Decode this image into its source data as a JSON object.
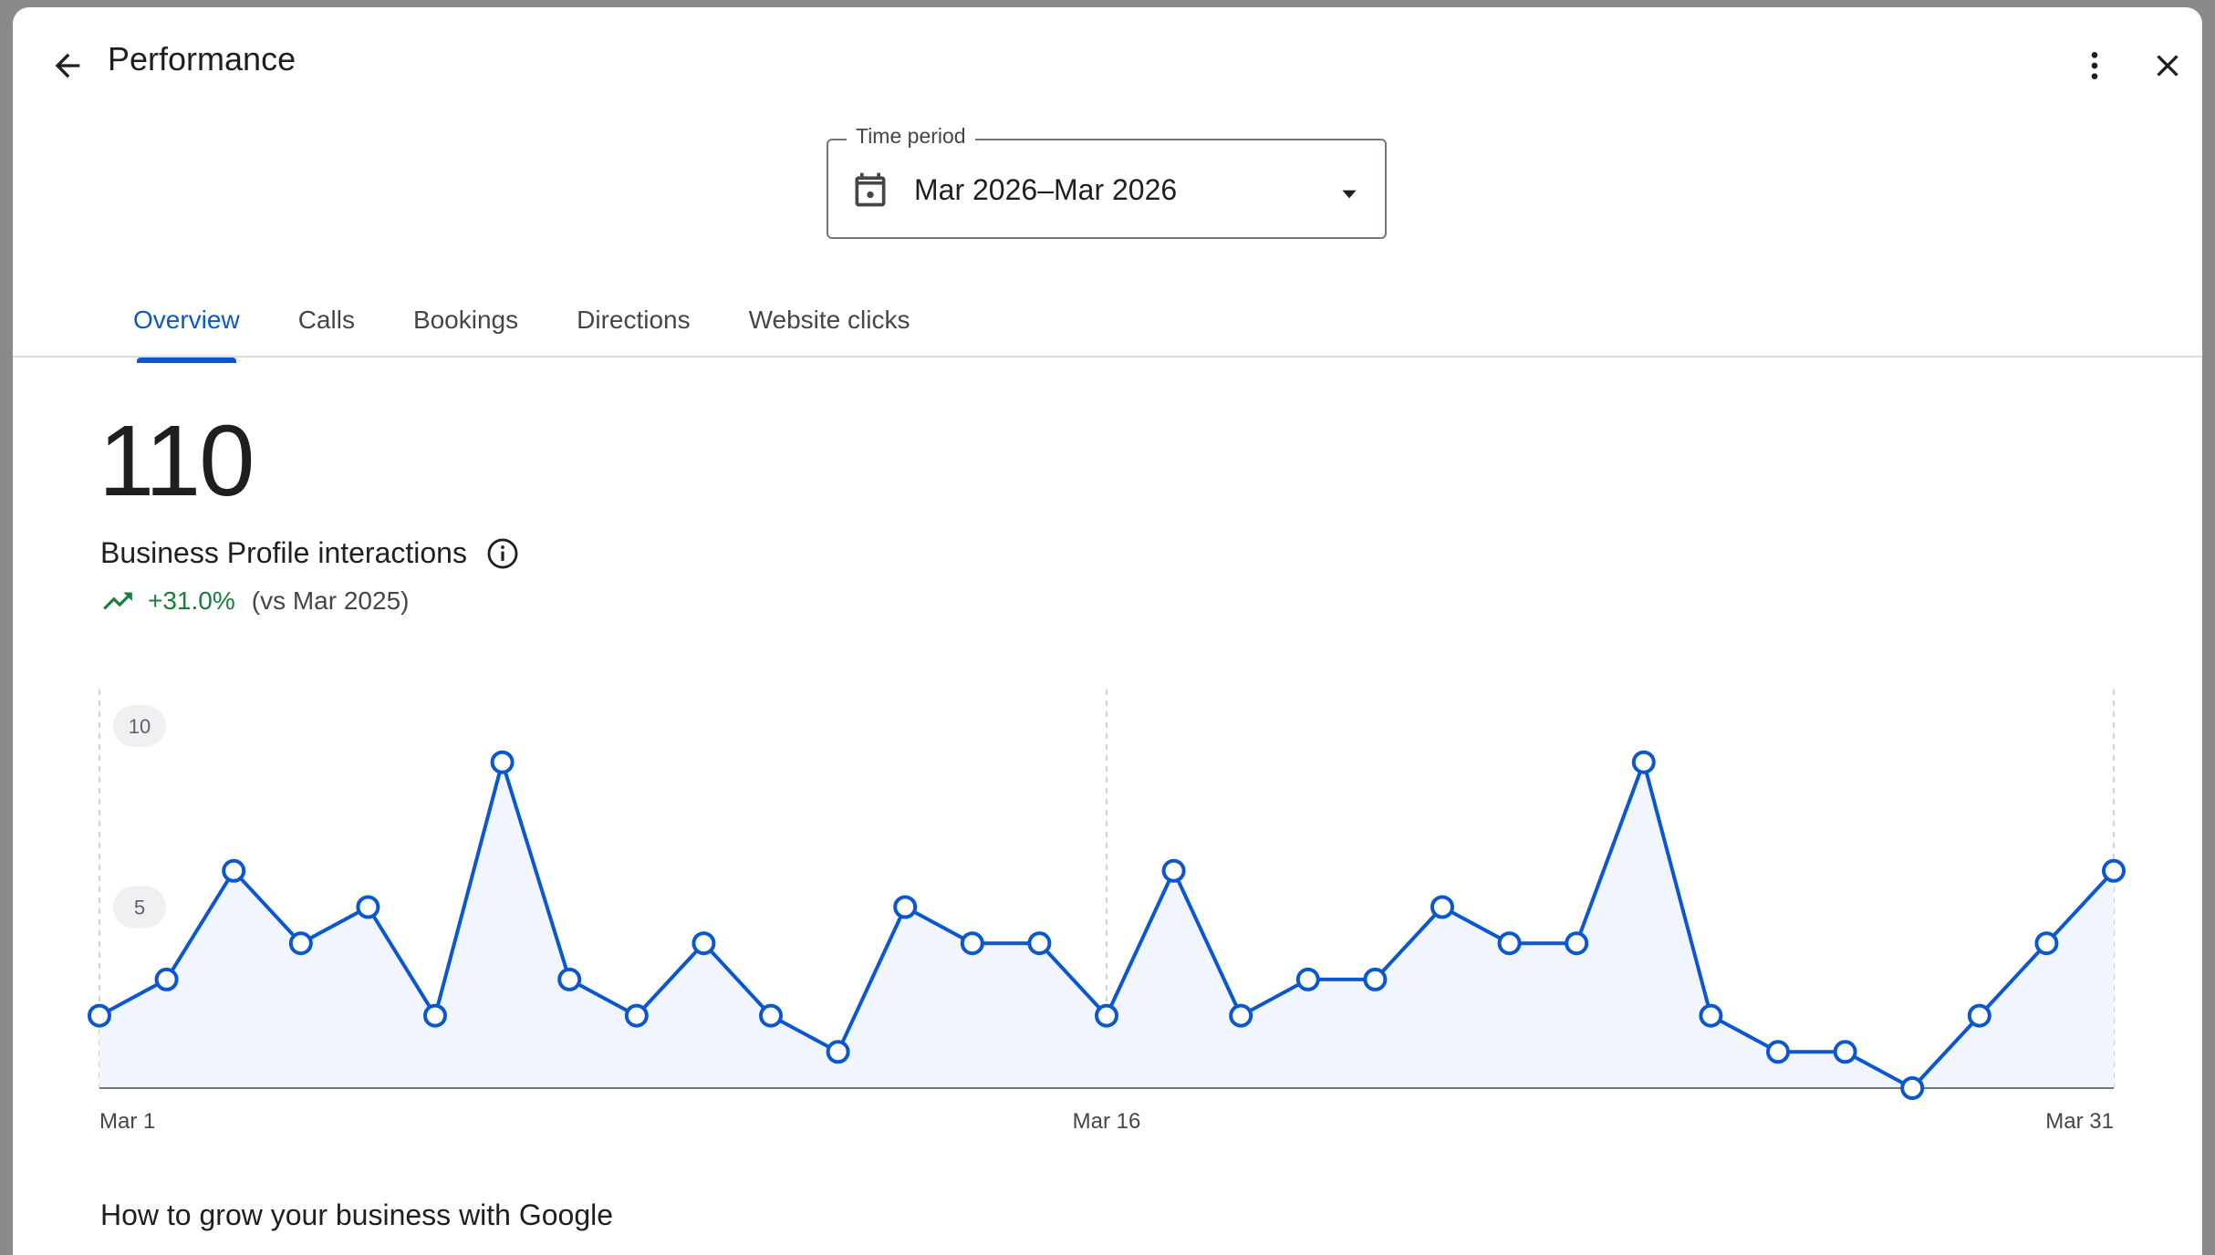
{
  "header": {
    "title": "Performance"
  },
  "time_period": {
    "label": "Time period",
    "value": "Mar 2026–Mar 2026"
  },
  "tabs": [
    {
      "label": "Overview",
      "active": true
    },
    {
      "label": "Calls"
    },
    {
      "label": "Bookings"
    },
    {
      "label": "Directions"
    },
    {
      "label": "Website clicks"
    }
  ],
  "metric": {
    "value": "110",
    "label": "Business Profile interactions",
    "change": "+31.0%",
    "comparison": "(vs Mar 2025)"
  },
  "colors": {
    "accent": "#0b57d0",
    "line": "#0b57d0",
    "area": "#f1f5fd",
    "trend_up": "#188038"
  },
  "chart_data": {
    "type": "area",
    "x": [
      "Mar 1",
      "Mar 2",
      "Mar 3",
      "Mar 4",
      "Mar 5",
      "Mar 6",
      "Mar 7",
      "Mar 8",
      "Mar 9",
      "Mar 10",
      "Mar 11",
      "Mar 12",
      "Mar 13",
      "Mar 14",
      "Mar 15",
      "Mar 16",
      "Mar 17",
      "Mar 18",
      "Mar 19",
      "Mar 20",
      "Mar 21",
      "Mar 22",
      "Mar 23",
      "Mar 24",
      "Mar 25",
      "Mar 26",
      "Mar 27",
      "Mar 28",
      "Mar 29",
      "Mar 30",
      "Mar 31"
    ],
    "series": [
      {
        "values": [
          2,
          3,
          6,
          4,
          5,
          2,
          9,
          3,
          2,
          4,
          2,
          1,
          5,
          4,
          4,
          2,
          6,
          2,
          3,
          3,
          5,
          4,
          4,
          9,
          2,
          1,
          1,
          0,
          2,
          4,
          6
        ]
      }
    ],
    "xticks": [
      "Mar 1",
      "Mar 16",
      "Mar 31"
    ],
    "yticks": [
      5,
      10
    ],
    "ylim": [
      0,
      10
    ],
    "grid": "vertical-dashed"
  },
  "section": {
    "heading": "How to grow your business with Google"
  },
  "icons": {
    "back": "arrow-back-icon",
    "more": "more-vert-icon",
    "close": "close-icon",
    "calendar": "calendar-icon",
    "dropdown": "arrow-drop-down-icon",
    "info": "info-icon",
    "trend": "trending-up-icon"
  }
}
